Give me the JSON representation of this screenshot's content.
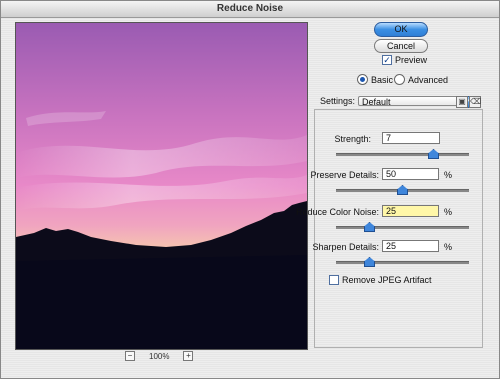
{
  "window": {
    "title": "Reduce Noise"
  },
  "buttons": {
    "ok": "OK",
    "cancel": "Cancel"
  },
  "preview": {
    "checkbox_label": "Preview",
    "checked": true
  },
  "mode": {
    "basic": "Basic",
    "advanced": "Advanced",
    "selected": "Basic"
  },
  "settings": {
    "label": "Settings:",
    "value": "Default"
  },
  "zoom": {
    "minus": "−",
    "plus": "+",
    "level": "100%"
  },
  "controls": {
    "strength": {
      "label": "Strength:",
      "value": "7",
      "level": 0.7
    },
    "preserve_details": {
      "label": "Preserve Details:",
      "value": "50",
      "unit": "%",
      "level": 0.5
    },
    "reduce_color_noise": {
      "label": "Reduce Color Noise:",
      "value": "25",
      "unit": "%",
      "level": 0.25
    },
    "sharpen_details": {
      "label": "Sharpen Details:",
      "value": "25",
      "unit": "%",
      "level": 0.25
    }
  },
  "remove_jpeg": {
    "label": "Remove JPEG Artifact",
    "checked": false
  },
  "colors": {
    "accent": "#2f7fd6",
    "highlight_field": "#fff7a8"
  }
}
